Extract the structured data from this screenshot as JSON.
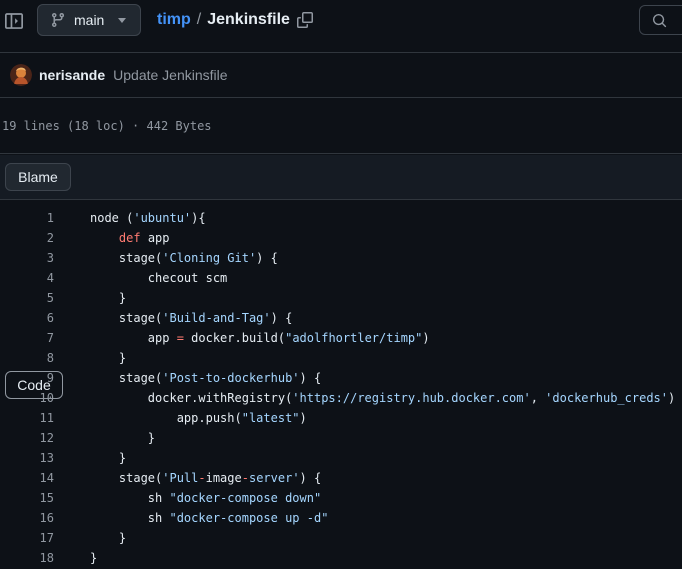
{
  "header": {
    "branch": "main",
    "repo": "timp",
    "separator": "/",
    "file": "Jenkinsfile"
  },
  "commit": {
    "author": "nerisande",
    "message": "Update Jenkinsfile"
  },
  "file_info": "19 lines (18 loc) · 442 Bytes",
  "view_tabs": [
    "Code",
    "Blame"
  ],
  "code_lines": [
    {
      "n": "1",
      "tokens": [
        {
          "t": "node (",
          "c": ""
        },
        {
          "t": "'ubuntu'",
          "c": "str"
        },
        {
          "t": "){",
          "c": ""
        }
      ]
    },
    {
      "n": "2",
      "tokens": [
        {
          "t": "    ",
          "c": ""
        },
        {
          "t": "def",
          "c": "kw"
        },
        {
          "t": " app",
          "c": ""
        }
      ]
    },
    {
      "n": "3",
      "tokens": [
        {
          "t": "    stage(",
          "c": ""
        },
        {
          "t": "'Cloning Git'",
          "c": "str"
        },
        {
          "t": ") {",
          "c": ""
        }
      ]
    },
    {
      "n": "4",
      "tokens": [
        {
          "t": "        checout scm",
          "c": ""
        }
      ]
    },
    {
      "n": "5",
      "tokens": [
        {
          "t": "    }",
          "c": ""
        }
      ]
    },
    {
      "n": "6",
      "tokens": [
        {
          "t": "    stage(",
          "c": ""
        },
        {
          "t": "'Build-and-Tag'",
          "c": "str"
        },
        {
          "t": ") {",
          "c": ""
        }
      ]
    },
    {
      "n": "7",
      "tokens": [
        {
          "t": "        app ",
          "c": ""
        },
        {
          "t": "=",
          "c": "op"
        },
        {
          "t": " docker.build(",
          "c": ""
        },
        {
          "t": "\"adolfhortler/timp\"",
          "c": "str"
        },
        {
          "t": ")",
          "c": ""
        }
      ]
    },
    {
      "n": "8",
      "tokens": [
        {
          "t": "    }",
          "c": ""
        }
      ]
    },
    {
      "n": "9",
      "tokens": [
        {
          "t": "    stage(",
          "c": ""
        },
        {
          "t": "'Post-to-dockerhub'",
          "c": "str"
        },
        {
          "t": ") {",
          "c": ""
        }
      ]
    },
    {
      "n": "10",
      "tokens": [
        {
          "t": "        docker.withRegistry(",
          "c": ""
        },
        {
          "t": "'https://registry.hub.docker.com'",
          "c": "str"
        },
        {
          "t": ", ",
          "c": ""
        },
        {
          "t": "'dockerhub_creds'",
          "c": "str"
        },
        {
          "t": ") {",
          "c": ""
        }
      ]
    },
    {
      "n": "11",
      "tokens": [
        {
          "t": "            app.push(",
          "c": ""
        },
        {
          "t": "\"latest\"",
          "c": "str"
        },
        {
          "t": ")",
          "c": ""
        }
      ]
    },
    {
      "n": "12",
      "tokens": [
        {
          "t": "        }",
          "c": ""
        }
      ]
    },
    {
      "n": "13",
      "tokens": [
        {
          "t": "    }",
          "c": ""
        }
      ]
    },
    {
      "n": "14",
      "tokens": [
        {
          "t": "    stage(",
          "c": ""
        },
        {
          "t": "'Pull",
          "c": "str"
        },
        {
          "t": "-",
          "c": "op"
        },
        {
          "t": "image",
          "c": ""
        },
        {
          "t": "-",
          "c": "op"
        },
        {
          "t": "server'",
          "c": "str"
        },
        {
          "t": ") {",
          "c": ""
        }
      ]
    },
    {
      "n": "15",
      "tokens": [
        {
          "t": "        sh ",
          "c": ""
        },
        {
          "t": "\"docker-compose down\"",
          "c": "str"
        }
      ]
    },
    {
      "n": "16",
      "tokens": [
        {
          "t": "        sh ",
          "c": ""
        },
        {
          "t": "\"docker-compose up -d\"",
          "c": "str"
        }
      ]
    },
    {
      "n": "17",
      "tokens": [
        {
          "t": "    }",
          "c": ""
        }
      ]
    },
    {
      "n": "18",
      "tokens": [
        {
          "t": "}",
          "c": ""
        }
      ]
    }
  ],
  "colors": {
    "background": "#0d1117",
    "link": "#4493f8",
    "string": "#a5d6ff",
    "keyword": "#ff7b72",
    "muted": "#9198a1"
  },
  "icons": [
    "sidebar-panel-icon",
    "git-branch-icon",
    "chevron-down-icon",
    "copy-icon",
    "search-icon",
    "avatar"
  ]
}
